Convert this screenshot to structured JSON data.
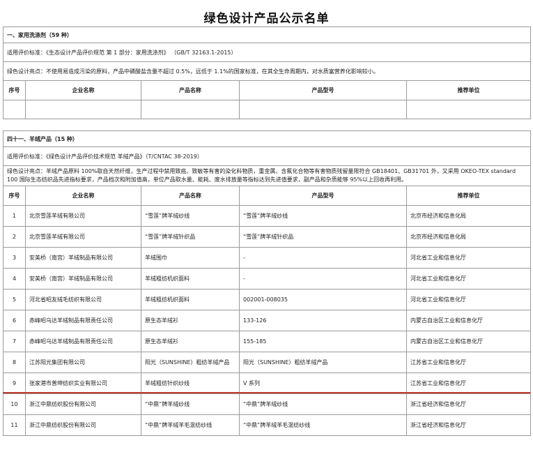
{
  "title": "绿色设计产品公示名单",
  "section1": {
    "heading": "一、家用洗涤剂（59 种）",
    "standard": "适用评价标准：《生态设计产品评价规范 第 1 部分：家用洗涤剂》 （GB/T 32163.1-2015）",
    "highlights": "绿色设计亮点：不使用易造成污染的原料，产品中磷酸盐含量不超过 0.5%，远低于 1.1%的国家标准，在其全生命周期内，对水质富营养化影响较小。",
    "columns": [
      "序号",
      "企业名称",
      "产品名称",
      "产品型号",
      "推荐单位"
    ]
  },
  "section41": {
    "heading": "四十一、羊绒产品（15 种）",
    "standard": "适用评价标准：《绿色设计产品评价技术规范 羊绒产品》（T/CNTAC 38-2019）",
    "highlights": "绿色设计亮点：羊绒产品原料 100%取自天然纤维，生产过程中禁用致癌、致敏等有害的染化料物质，重金属、含氟化合物等有害物质残留量限符合 GB18401、GB31701 外，又采用 OKEO-TEX standard 100 国际生态纺织品先进指标要求，产品档次和附加值高，单位产品取水量、能耗、废水排放量等指标达到先进值要求，副产品和杂质能够 95%以上回收再利用。",
    "columns": [
      "序号",
      "企业名称",
      "产品名称",
      "产品型号",
      "推荐单位"
    ],
    "rows": [
      {
        "no": "1",
        "company": "北京雪莲羊绒有限公司",
        "product": "“雪莲”牌羊绒纱线",
        "model": "“雪莲”牌羊绒纱线",
        "recommender": "北京市经济和信息化局"
      },
      {
        "no": "2",
        "company": "北京雪莲羊绒有限公司",
        "product": "“雪莲”牌羊绒针织品",
        "model": "“雪莲”牌羊绒针织品",
        "recommender": "北京市经济和信息化局"
      },
      {
        "no": "3",
        "company": "安美桥（南宫）羊绒制品有限公司",
        "product": "羊绒围巾",
        "model": "-",
        "recommender": "河北省工业和信息化厅"
      },
      {
        "no": "4",
        "company": "安美桥（南宫）羊绒制品有限公司",
        "product": "羊绒粗纺机织面料",
        "model": "-",
        "recommender": "河北省工业和信息化厅"
      },
      {
        "no": "5",
        "company": "河北省昭友绒毛纺织有限公司",
        "product": "羊绒粗纺机织面料",
        "model": "002001-008035",
        "recommender": "河北省工业和信息化厅"
      },
      {
        "no": "6",
        "company": "赤峰昭乌达羊绒制品有限责任公司",
        "product": "原生态羊绒衫",
        "model": "133-126",
        "recommender": "内蒙古自治区工业和信息化厅"
      },
      {
        "no": "7",
        "company": "赤峰昭乌达羊绒制品有限责任公司",
        "product": "原生态羊绒衫",
        "model": "155-185",
        "recommender": "内蒙古自治区工业和信息化厅"
      },
      {
        "no": "8",
        "company": "江苏阳光集团有限公司",
        "product": "阳光（SUNSHINE）粗纺羊绒产品",
        "model": "阳光（SUNSHINE）粗纺羊绒产品",
        "recommender": "江苏省工业和信息化厅"
      },
      {
        "no": "9",
        "company": "张家港市普坤纺织实业有限公司",
        "product": "羊绒粗纺针织纱线",
        "model": "V 系列",
        "recommender": "江苏省工业和信息化厅"
      },
      {
        "no": "10",
        "company": "浙江中鼎纺织股份有限公司",
        "product": "“中鼎”牌羊绒纱线",
        "model": "“中鼎”牌羊绒纱线",
        "recommender": "浙江省经济和信息化厅"
      },
      {
        "no": "11",
        "company": "浙江中鼎纺织股份有限公司",
        "product": "“中鼎”牌羊绒羊毛混纺纱线",
        "model": "“中鼎”牌羊绒羊毛混纺纱线",
        "recommender": "浙江省经济和信息化厅"
      }
    ]
  },
  "colors": {
    "border": "#9a9a9a",
    "highlight_line": "#c0392b"
  }
}
